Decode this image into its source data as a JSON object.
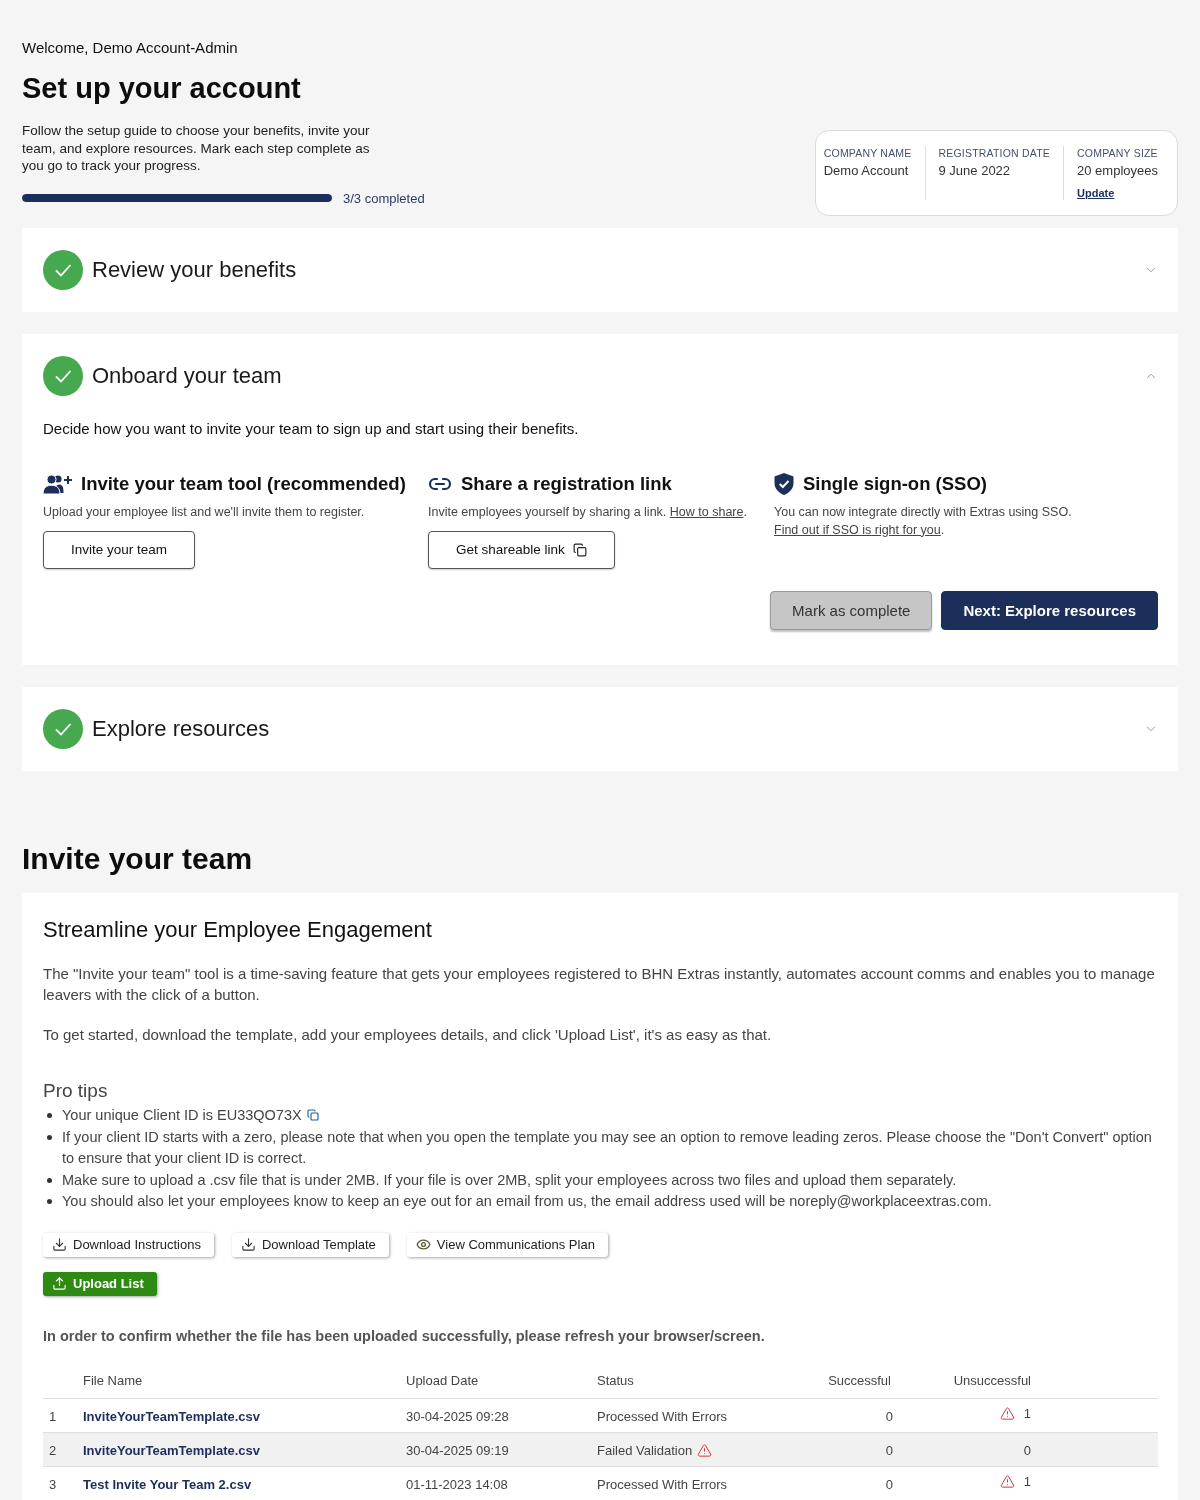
{
  "header": {
    "welcome": "Welcome, Demo Account-Admin",
    "title": "Set up your account",
    "description": "Follow the setup guide to choose your benefits, invite your team, and explore resources. Mark each step complete as you go to track your progress.",
    "progress": {
      "level": 1,
      "label": "3/3 completed"
    }
  },
  "company_info": [
    {
      "label": "COMPANY NAME",
      "value": "Demo Account"
    },
    {
      "label": "REGISTRATION DATE",
      "value": "9 June 2022"
    },
    {
      "label": "COMPANY SIZE",
      "value": "20 employees",
      "link": "Update"
    }
  ],
  "steps": [
    {
      "title": "Review your benefits",
      "completed": true,
      "expanded": false
    },
    {
      "title": "Onboard your team",
      "completed": true,
      "expanded": true,
      "description": "Decide how you want to invite your team to sign up and start using their benefits.",
      "options": [
        {
          "kind": "tool",
          "title": "Invite your team tool (recommended)",
          "text": "Upload your employee list and we'll invite them to register.",
          "button": "Invite your team"
        },
        {
          "kind": "link",
          "title": "Share a registration link",
          "text": "Invite employees yourself by sharing a link.",
          "link": "How to share",
          "after_link": ".",
          "button": "Get shareable link"
        },
        {
          "kind": "sso",
          "title": "Single sign-on (SSO)",
          "text": "You can now integrate directly with Extras using SSO.",
          "link": "Find out if SSO is right for you",
          "after_link": "."
        }
      ],
      "actions": [
        {
          "label": "Mark as complete",
          "kind": "secondary"
        },
        {
          "label": "Next: Explore resources",
          "kind": "primary"
        }
      ]
    },
    {
      "title": "Explore resources",
      "completed": true,
      "expanded": false
    }
  ],
  "invite_section": {
    "title": "Invite your team",
    "card_title": "Streamline your Employee Engagement",
    "paragraphs": [
      "The \"Invite your team\" tool is a time-saving feature that gets your employees registered to BHN Extras instantly, automates account comms and enables you to manage leavers with the click of a button.",
      "To get started, download the template, add your employees details, and click 'Upload List', it's as easy as that."
    ],
    "pro_tips": {
      "title": "Pro tips",
      "items": [
        {
          "text": "Your unique Client ID is EU33QO73X",
          "copy": true
        },
        {
          "text": "If your client ID starts with a zero, please note that when you open the template you may see an option to remove leading zeros. Please choose the \"Don't Convert\" option to ensure that your client ID is correct.",
          "copy": false
        },
        {
          "text": "Make sure to upload a .csv file that is under 2MB. If your file is over 2MB, split your employees across two files and upload them separately.",
          "copy": false
        },
        {
          "text": "You should also let your employees know to keep an eye out for an email from us, the email address used will be noreply@workplaceextras.com.",
          "copy": false
        }
      ]
    },
    "buttons": [
      {
        "label": "Download Instructions",
        "kind": "download"
      },
      {
        "label": "Download Template",
        "kind": "download"
      },
      {
        "label": "View Communications Plan",
        "kind": "view"
      },
      {
        "label": "Upload List",
        "kind": "upload"
      }
    ],
    "note": "In order to confirm whether the file has been uploaded successfully, please refresh your browser/screen.",
    "table": {
      "columns": [
        "File Name",
        "Upload Date",
        "Status",
        "Successful",
        "Unsuccessful"
      ],
      "rows": [
        {
          "number": "1",
          "file_name": "InviteYourTeamTemplate.csv",
          "upload_date": "30-04-2025 09:28",
          "status": "Processed With Errors",
          "status_warning": false,
          "successful": "0",
          "unsuccessful": "1",
          "unsuccessful_warning": true
        },
        {
          "number": "2",
          "file_name": "InviteYourTeamTemplate.csv",
          "upload_date": "30-04-2025 09:19",
          "status": "Failed Validation",
          "status_warning": true,
          "successful": "0",
          "unsuccessful": "0",
          "unsuccessful_warning": false
        },
        {
          "number": "3",
          "file_name": "Test Invite Your Team 2.csv",
          "upload_date": "01-11-2023 14:08",
          "status": "Processed With Errors",
          "status_warning": false,
          "successful": "0",
          "unsuccessful": "1",
          "unsuccessful_warning": true
        }
      ]
    }
  }
}
